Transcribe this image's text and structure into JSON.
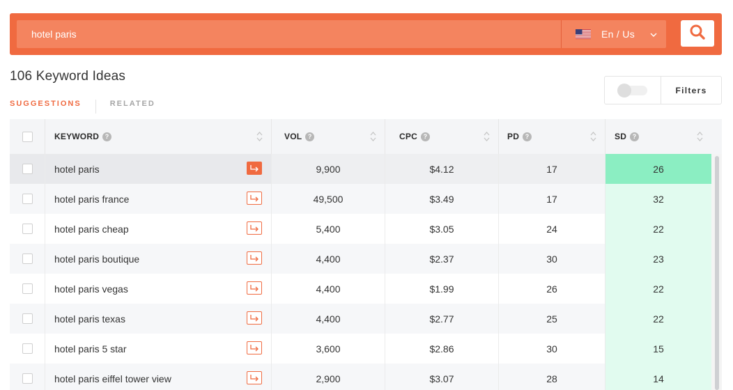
{
  "search": {
    "query": "hotel paris",
    "language": "En / Us",
    "flag_icon": "us-flag-icon",
    "button_icon": "search-icon"
  },
  "results": {
    "count_title": "106 Keyword Ideas"
  },
  "tabs": {
    "suggestions": "SUGGESTIONS",
    "related": "RELATED"
  },
  "filters": {
    "label": "Filters",
    "toggle_on": false
  },
  "table": {
    "columns": {
      "keyword": "KEYWORD",
      "vol": "VOL",
      "cpc": "CPC",
      "pd": "PD",
      "sd": "SD"
    },
    "rows": [
      {
        "keyword": "hotel paris",
        "vol": "9,900",
        "cpc": "$4.12",
        "pd": "17",
        "sd": "26"
      },
      {
        "keyword": "hotel paris france",
        "vol": "49,500",
        "cpc": "$3.49",
        "pd": "17",
        "sd": "32"
      },
      {
        "keyword": "hotel paris cheap",
        "vol": "5,400",
        "cpc": "$3.05",
        "pd": "24",
        "sd": "22"
      },
      {
        "keyword": "hotel paris boutique",
        "vol": "4,400",
        "cpc": "$2.37",
        "pd": "30",
        "sd": "23"
      },
      {
        "keyword": "hotel paris vegas",
        "vol": "4,400",
        "cpc": "$1.99",
        "pd": "26",
        "sd": "22"
      },
      {
        "keyword": "hotel paris texas",
        "vol": "4,400",
        "cpc": "$2.77",
        "pd": "25",
        "sd": "22"
      },
      {
        "keyword": "hotel paris 5 star",
        "vol": "3,600",
        "cpc": "$2.86",
        "pd": "30",
        "sd": "15"
      },
      {
        "keyword": "hotel paris eiffel tower view",
        "vol": "2,900",
        "cpc": "$3.07",
        "pd": "28",
        "sd": "14"
      }
    ]
  },
  "colors": {
    "accent": "#f06a40",
    "sd_highlight": "#8beec2",
    "sd_background": "#e1fbef"
  }
}
